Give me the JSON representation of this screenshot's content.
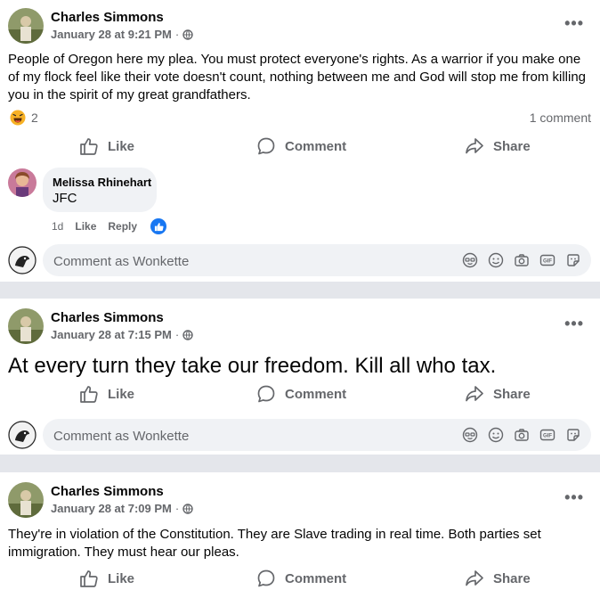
{
  "posts": [
    {
      "author": "Charles Simmons",
      "timestamp": "January 28 at 9:21 PM",
      "separator": "·",
      "text": "People of Oregon here my plea. You must protect everyone's rights. As a warrior if you make one of my flock feel like their vote doesn't count, nothing between me and God will stop me from killing you in the spirit of my great grandfathers.",
      "reaction_count": "2",
      "comment_count": "1 comment",
      "actions": {
        "like": "Like",
        "comment": "Comment",
        "share": "Share"
      },
      "comment": {
        "name": "Melissa Rhinehart",
        "text": "JFC",
        "age": "1d",
        "like": "Like",
        "reply": "Reply"
      },
      "composer_placeholder": "Comment as Wonkette"
    },
    {
      "author": "Charles Simmons",
      "timestamp": "January 28 at 7:15 PM",
      "separator": "·",
      "text": "At every turn they take our freedom. Kill all who tax.",
      "actions": {
        "like": "Like",
        "comment": "Comment",
        "share": "Share"
      },
      "composer_placeholder": "Comment as Wonkette"
    },
    {
      "author": "Charles Simmons",
      "timestamp": "January 28 at 7:09 PM",
      "separator": "·",
      "text": "They're in violation of the Constitution. They are Slave trading in real time. Both parties set immigration. They must hear our pleas.",
      "actions": {
        "like": "Like",
        "comment": "Comment",
        "share": "Share"
      }
    }
  ],
  "icons": {
    "more": "more-options-icon",
    "privacy": "globe-icon",
    "reaction": "haha-reaction-icon",
    "like": "thumbs-up-icon",
    "comment": "comment-bubble-icon",
    "share": "share-arrow-icon",
    "avatar_sticker": "avatar-sticker-icon",
    "emoji": "emoji-icon",
    "camera": "camera-icon",
    "gif": "gif-icon",
    "sticker": "sticker-icon"
  },
  "colors": {
    "background": "#e4e6eb",
    "card": "#ffffff",
    "bubble": "#f0f2f5",
    "secondary_text": "#65676b",
    "like_blue": "#1877f2"
  }
}
